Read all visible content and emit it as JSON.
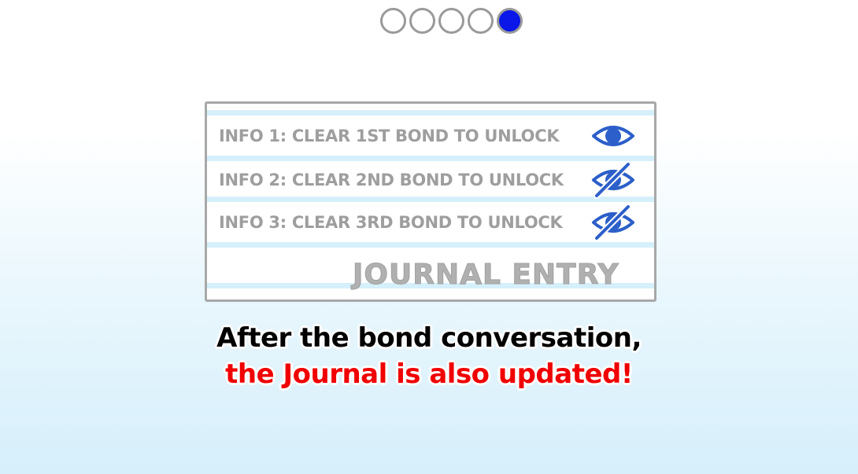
{
  "pagination": {
    "count": 5,
    "active_index": 4,
    "active_color": "#0a17e8"
  },
  "journal": {
    "entries": [
      {
        "label": "INFO 1: CLEAR 1ST BOND TO UNLOCK",
        "icon": "eye-icon"
      },
      {
        "label": "INFO 2: CLEAR 2ND BOND TO UNLOCK",
        "icon": "eye-slash-icon"
      },
      {
        "label": "INFO 3: CLEAR 3RD BOND TO UNLOCK",
        "icon": "eye-slash-icon"
      }
    ],
    "title": "JOURNAL ENTRY",
    "icon_color": "#2c5fc9"
  },
  "caption": {
    "line1": "After the bond conversation,",
    "line2": "the Journal is also updated!",
    "line1_color": "#000000",
    "line2_color": "#f00000"
  }
}
